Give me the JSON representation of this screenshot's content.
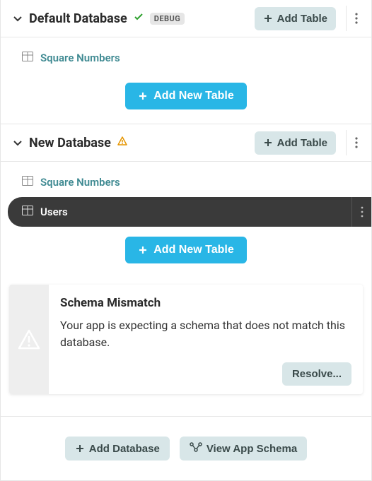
{
  "databases": [
    {
      "title": "Default Database",
      "status": "ok",
      "debug": "DEBUG",
      "add_table_btn": "Add Table",
      "tables": [
        {
          "name": "Square Numbers",
          "active": false
        }
      ],
      "add_new_table": "Add New Table"
    },
    {
      "title": "New Database",
      "status": "warn",
      "add_table_btn": "Add Table",
      "tables": [
        {
          "name": "Square Numbers",
          "active": false
        },
        {
          "name": "Users",
          "active": true
        }
      ],
      "add_new_table": "Add New Table"
    }
  ],
  "warning": {
    "title": "Schema Mismatch",
    "message": "Your app is expecting a schema that does not match this database.",
    "resolve": "Resolve..."
  },
  "footer": {
    "add_db": "Add Database",
    "view_schema": "View App Schema"
  }
}
